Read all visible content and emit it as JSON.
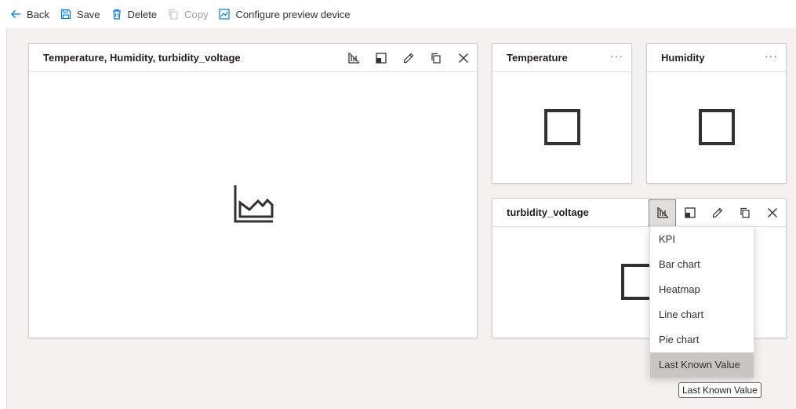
{
  "toolbar": {
    "back": "Back",
    "save": "Save",
    "delete": "Delete",
    "copy": "Copy",
    "configure": "Configure preview device"
  },
  "tiles": [
    {
      "title": "Temperature, Humidity, turbidity_voltage",
      "visual": "area-chart-icon"
    },
    {
      "title": "Temperature",
      "visual": "square"
    },
    {
      "title": "Humidity",
      "visual": "square"
    },
    {
      "title": "turbidity_voltage",
      "visual": "square"
    }
  ],
  "tile_actions": {
    "more": "···"
  },
  "visualization_menu": {
    "items": [
      "KPI",
      "Bar chart",
      "Heatmap",
      "Line chart",
      "Pie chart",
      "Last Known Value"
    ],
    "highlighted": "Last Known Value",
    "tooltip": "Last Known Value"
  },
  "colors": {
    "accent": "#0078d4",
    "icon": "#323130",
    "canvas": "#f3f2f1",
    "disabled": "#a19f9d"
  }
}
